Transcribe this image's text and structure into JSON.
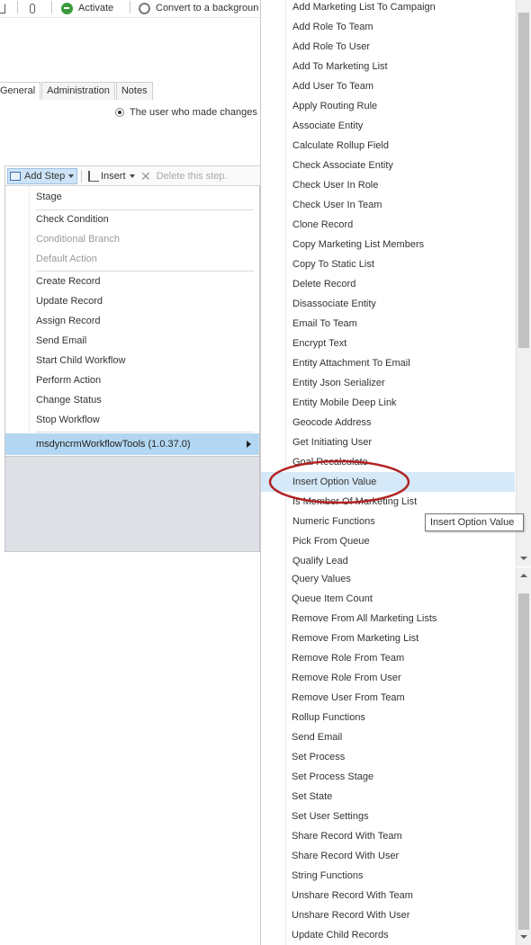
{
  "toolbar": {
    "activate_label": "Activate",
    "convert_label": "Convert to a backgroun"
  },
  "tabs": [
    {
      "label": "General"
    },
    {
      "label": "Administration"
    },
    {
      "label": "Notes"
    }
  ],
  "radio_option": {
    "label": "The user who made changes t"
  },
  "step_toolbar": {
    "add_step_label": "Add Step",
    "insert_label": "Insert",
    "delete_label": "Delete this step."
  },
  "step_menu": {
    "items": [
      {
        "label": "Stage"
      },
      {
        "label": "Check Condition"
      },
      {
        "label": "Conditional Branch"
      },
      {
        "label": "Default Action"
      },
      {
        "label": "Create Record"
      },
      {
        "label": "Update Record"
      },
      {
        "label": "Assign Record"
      },
      {
        "label": "Send Email"
      },
      {
        "label": "Start Child Workflow"
      },
      {
        "label": "Perform Action"
      },
      {
        "label": "Change Status"
      },
      {
        "label": "Stop Workflow"
      }
    ],
    "highlighted_item": "msdyncrmWorkflowTools (1.0.37.0)"
  },
  "action_menu": {
    "items": [
      {
        "label": "Add Marketing List To Campaign"
      },
      {
        "label": "Add Role To Team"
      },
      {
        "label": "Add Role To User"
      },
      {
        "label": "Add To Marketing List"
      },
      {
        "label": "Add User To Team"
      },
      {
        "label": "Apply Routing Rule"
      },
      {
        "label": "Associate Entity"
      },
      {
        "label": "Calculate Rollup Field"
      },
      {
        "label": "Check Associate Entity"
      },
      {
        "label": "Check User In Role"
      },
      {
        "label": "Check User In Team"
      },
      {
        "label": "Clone Record"
      },
      {
        "label": "Copy Marketing List Members"
      },
      {
        "label": "Copy To Static List"
      },
      {
        "label": "Delete Record"
      },
      {
        "label": "Disassociate Entity"
      },
      {
        "label": "Email To Team"
      },
      {
        "label": "Encrypt Text"
      },
      {
        "label": "Entity Attachment To Email"
      },
      {
        "label": "Entity Json Serializer"
      },
      {
        "label": "Entity Mobile Deep Link"
      },
      {
        "label": "Geocode Address"
      },
      {
        "label": "Get Initiating User"
      },
      {
        "label": "Goal Recalculate"
      },
      {
        "label": "Insert Option Value"
      },
      {
        "label": "Is Member Of Marketing List"
      },
      {
        "label": "Numeric Functions"
      },
      {
        "label": "Pick From Queue"
      },
      {
        "label": "Qualify Lead"
      },
      {
        "label": "Query Values"
      },
      {
        "label": "Queue Item Count"
      },
      {
        "label": "Remove From All Marketing Lists"
      },
      {
        "label": "Remove From Marketing List"
      },
      {
        "label": "Remove Role From Team"
      },
      {
        "label": "Remove Role From User"
      },
      {
        "label": "Remove User From Team"
      },
      {
        "label": "Rollup Functions"
      },
      {
        "label": "Send Email"
      },
      {
        "label": "Set Process"
      },
      {
        "label": "Set Process Stage"
      },
      {
        "label": "Set State"
      },
      {
        "label": "Set User Settings"
      },
      {
        "label": "Share Record With Team"
      },
      {
        "label": "Share Record With User"
      },
      {
        "label": "String Functions"
      },
      {
        "label": "Unshare Record With Team"
      },
      {
        "label": "Unshare Record With User"
      },
      {
        "label": "Update Child Records"
      }
    ],
    "hovered_item": "Insert Option Value"
  },
  "tooltip": {
    "text": "Insert Option Value"
  },
  "colors": {
    "highlight": "#b3d7f2",
    "hover": "#d6e9f8",
    "annotation_circle": "#b22222"
  }
}
